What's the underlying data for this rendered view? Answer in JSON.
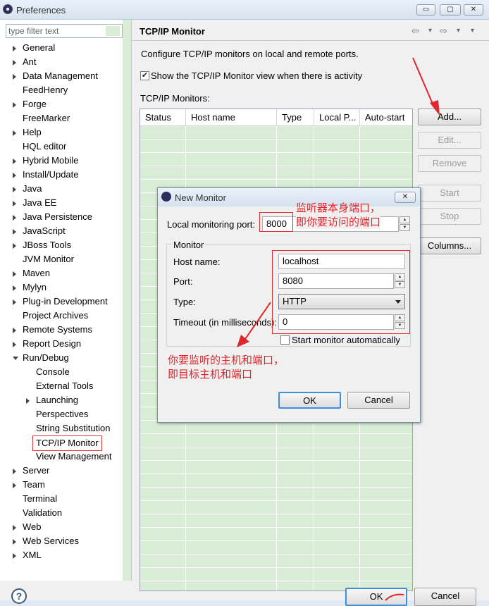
{
  "window": {
    "title": "Preferences",
    "buttons": [
      "▭",
      "▢",
      "✕"
    ]
  },
  "filter": {
    "placeholder": "type filter text"
  },
  "tree": [
    {
      "label": "General",
      "expand": "closed",
      "level": 0
    },
    {
      "label": "Ant",
      "expand": "closed",
      "level": 0
    },
    {
      "label": "Data Management",
      "expand": "closed",
      "level": 0
    },
    {
      "label": "FeedHenry",
      "expand": "none",
      "level": 0
    },
    {
      "label": "Forge",
      "expand": "closed",
      "level": 0
    },
    {
      "label": "FreeMarker",
      "expand": "none",
      "level": 0
    },
    {
      "label": "Help",
      "expand": "closed",
      "level": 0
    },
    {
      "label": "HQL editor",
      "expand": "none",
      "level": 0
    },
    {
      "label": "Hybrid Mobile",
      "expand": "closed",
      "level": 0
    },
    {
      "label": "Install/Update",
      "expand": "closed",
      "level": 0
    },
    {
      "label": "Java",
      "expand": "closed",
      "level": 0
    },
    {
      "label": "Java EE",
      "expand": "closed",
      "level": 0
    },
    {
      "label": "Java Persistence",
      "expand": "closed",
      "level": 0
    },
    {
      "label": "JavaScript",
      "expand": "closed",
      "level": 0
    },
    {
      "label": "JBoss Tools",
      "expand": "closed",
      "level": 0
    },
    {
      "label": "JVM Monitor",
      "expand": "none",
      "level": 0
    },
    {
      "label": "Maven",
      "expand": "closed",
      "level": 0
    },
    {
      "label": "Mylyn",
      "expand": "closed",
      "level": 0
    },
    {
      "label": "Plug-in Development",
      "expand": "closed",
      "level": 0
    },
    {
      "label": "Project Archives",
      "expand": "none",
      "level": 0
    },
    {
      "label": "Remote Systems",
      "expand": "closed",
      "level": 0
    },
    {
      "label": "Report Design",
      "expand": "closed",
      "level": 0
    },
    {
      "label": "Run/Debug",
      "expand": "open",
      "level": 0
    },
    {
      "label": "Console",
      "expand": "none",
      "level": 1
    },
    {
      "label": "External Tools",
      "expand": "none",
      "level": 1
    },
    {
      "label": "Launching",
      "expand": "closed-hollow",
      "level": 1
    },
    {
      "label": "Perspectives",
      "expand": "none",
      "level": 1
    },
    {
      "label": "String Substitution",
      "expand": "none",
      "level": 1
    },
    {
      "label": "TCP/IP Monitor",
      "expand": "none",
      "level": 1,
      "selected": true
    },
    {
      "label": "View Management",
      "expand": "none",
      "level": 1
    },
    {
      "label": "Server",
      "expand": "closed",
      "level": 0
    },
    {
      "label": "Team",
      "expand": "closed",
      "level": 0
    },
    {
      "label": "Terminal",
      "expand": "none",
      "level": 0
    },
    {
      "label": "Validation",
      "expand": "none",
      "level": 0
    },
    {
      "label": "Web",
      "expand": "closed",
      "level": 0
    },
    {
      "label": "Web Services",
      "expand": "closed",
      "level": 0
    },
    {
      "label": "XML",
      "expand": "closed",
      "level": 0
    }
  ],
  "page": {
    "title": "TCP/IP Monitor",
    "nav": [
      "⇦",
      "▾",
      "⇨",
      "▾",
      "▾"
    ],
    "description": "Configure TCP/IP monitors on local and remote ports.",
    "show_view_label": "Show the TCP/IP Monitor view when there is activity",
    "show_view_checked": true,
    "monitors_label": "TCP/IP Monitors:",
    "columns": [
      "Status",
      "Host name",
      "Type",
      "Local P...",
      "Auto-start"
    ],
    "buttons": {
      "add": "Add...",
      "edit": "Edit...",
      "remove": "Remove",
      "start": "Start",
      "stop": "Stop",
      "columns": "Columns..."
    }
  },
  "dialog": {
    "title": "New Monitor",
    "close": "✕",
    "local_port_label": "Local monitoring port:",
    "local_port_value": "8000",
    "group_label": "Monitor",
    "host_label": "Host name:",
    "host_value": "localhost",
    "port_label": "Port:",
    "port_value": "8080",
    "type_label": "Type:",
    "type_value": "HTTP",
    "timeout_label": "Timeout (in milliseconds):",
    "timeout_value": "0",
    "auto_start_label": "Start monitor automatically",
    "ok": "OK",
    "cancel": "Cancel"
  },
  "annotations": {
    "local_port_note_1": "监听器本身端口，",
    "local_port_note_2": "即你要访问的端口",
    "target_note_1": "你要监听的主机和端口，",
    "target_note_2": "即目标主机和端口",
    "color": "#e0262d"
  },
  "footer": {
    "help": "?",
    "ok": "OK",
    "cancel": "Cancel"
  }
}
